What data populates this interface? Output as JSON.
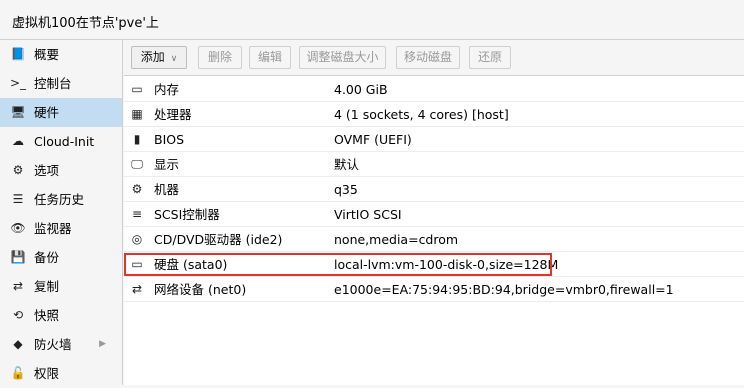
{
  "window": {
    "title": "虚拟机100在节点'pve'上"
  },
  "sidebar": {
    "items": [
      {
        "label": "概要",
        "icon": "book-icon",
        "glyph": "📘",
        "selected": false
      },
      {
        "label": "控制台",
        "icon": "terminal-icon",
        "glyph": ">_",
        "selected": false
      },
      {
        "label": "硬件",
        "icon": "monitor-icon",
        "glyph": "🖥",
        "selected": true
      },
      {
        "label": "Cloud-Init",
        "icon": "cloud-icon",
        "glyph": "☁",
        "selected": false
      },
      {
        "label": "选项",
        "icon": "gear-icon",
        "glyph": "⚙",
        "selected": false
      },
      {
        "label": "任务历史",
        "icon": "list-icon",
        "glyph": "☰",
        "selected": false
      },
      {
        "label": "监视器",
        "icon": "eye-icon",
        "glyph": "👁",
        "selected": false
      },
      {
        "label": "备份",
        "icon": "floppy-icon",
        "glyph": "💾",
        "selected": false
      },
      {
        "label": "复制",
        "icon": "retweet-icon",
        "glyph": "⇄",
        "selected": false
      },
      {
        "label": "快照",
        "icon": "history-icon",
        "glyph": "⟲",
        "selected": false
      },
      {
        "label": "防火墙",
        "icon": "shield-icon",
        "glyph": "◆",
        "selected": false,
        "expandable": true
      },
      {
        "label": "权限",
        "icon": "unlock-icon",
        "glyph": "🔓",
        "selected": false
      }
    ]
  },
  "toolbar": {
    "add": "添加",
    "delete": "删除",
    "edit": "编辑",
    "resize": "调整磁盘大小",
    "move": "移动磁盘",
    "revert": "还原"
  },
  "hardware": [
    {
      "name": "内存",
      "value": "4.00 GiB",
      "icon": "memory-icon",
      "glyph": "▭"
    },
    {
      "name": "处理器",
      "value": "4 (1 sockets, 4 cores) [host]",
      "icon": "cpu-icon",
      "glyph": "▦"
    },
    {
      "name": "BIOS",
      "value": "OVMF (UEFI)",
      "icon": "chip-icon",
      "glyph": "▮"
    },
    {
      "name": "显示",
      "value": "默认",
      "icon": "display-icon",
      "glyph": "🖵"
    },
    {
      "name": "机器",
      "value": "q35",
      "icon": "cogs-icon",
      "glyph": "⚙"
    },
    {
      "name": "SCSI控制器",
      "value": "VirtIO SCSI",
      "icon": "database-icon",
      "glyph": "≡"
    },
    {
      "name": "CD/DVD驱动器 (ide2)",
      "value": "none,media=cdrom",
      "icon": "cdrom-icon",
      "glyph": "◎"
    },
    {
      "name": "硬盘 (sata0)",
      "value": "local-lvm:vm-100-disk-0,size=128M",
      "icon": "hdd-icon",
      "glyph": "▭",
      "highlighted": true
    },
    {
      "name": "网络设备 (net0)",
      "value": "e1000e=EA:75:94:95:BD:94,bridge=vmbr0,firewall=1",
      "icon": "exchange-icon",
      "glyph": "⇄"
    }
  ]
}
